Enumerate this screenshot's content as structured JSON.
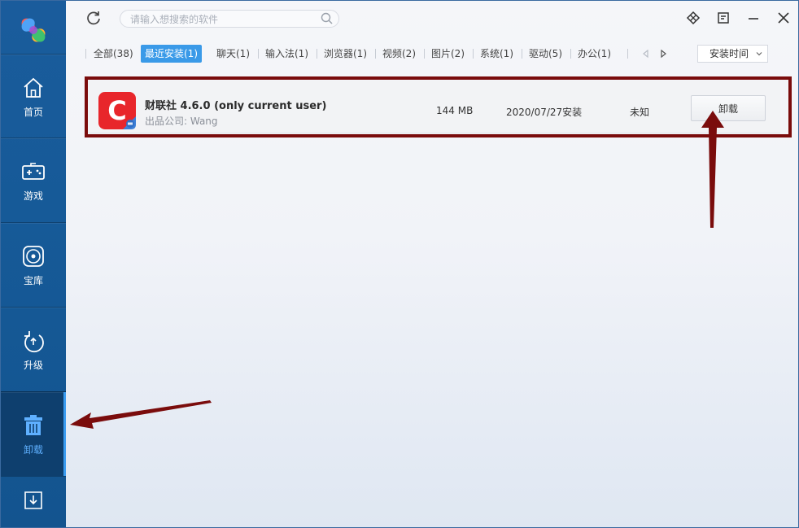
{
  "sidebar": {
    "items": [
      {
        "label": "首页",
        "icon": "home-icon"
      },
      {
        "label": "游戏",
        "icon": "gamepad-icon"
      },
      {
        "label": "宝库",
        "icon": "disc-icon"
      },
      {
        "label": "升级",
        "icon": "upgrade-icon"
      },
      {
        "label": "卸载",
        "icon": "trash-icon",
        "active": true
      },
      {
        "label": "",
        "icon": "download-icon"
      }
    ]
  },
  "search": {
    "placeholder": "请输入想搜索的软件"
  },
  "tabs": [
    {
      "label": "全部(38)"
    },
    {
      "label": "最近安装(1)",
      "active": true
    },
    {
      "label": "聊天(1)"
    },
    {
      "label": "输入法(1)"
    },
    {
      "label": "浏览器(1)"
    },
    {
      "label": "视频(2)"
    },
    {
      "label": "图片(2)"
    },
    {
      "label": "系统(1)"
    },
    {
      "label": "驱动(5)"
    },
    {
      "label": "办公(1)"
    }
  ],
  "sort": {
    "label": "安装时间"
  },
  "app": {
    "name": "财联社 4.6.0 (only current user)",
    "publisher": "出品公司: Wang",
    "size": "144 MB",
    "install_date": "2020/07/27安装",
    "rating": "未知",
    "uninstall_label": "卸载",
    "icon_letter": "C"
  },
  "colors": {
    "sidebar_bg": "#165a98",
    "tab_active": "#3a9ae8",
    "annotation": "#7a0c0c",
    "app_icon": "#e8262b"
  }
}
